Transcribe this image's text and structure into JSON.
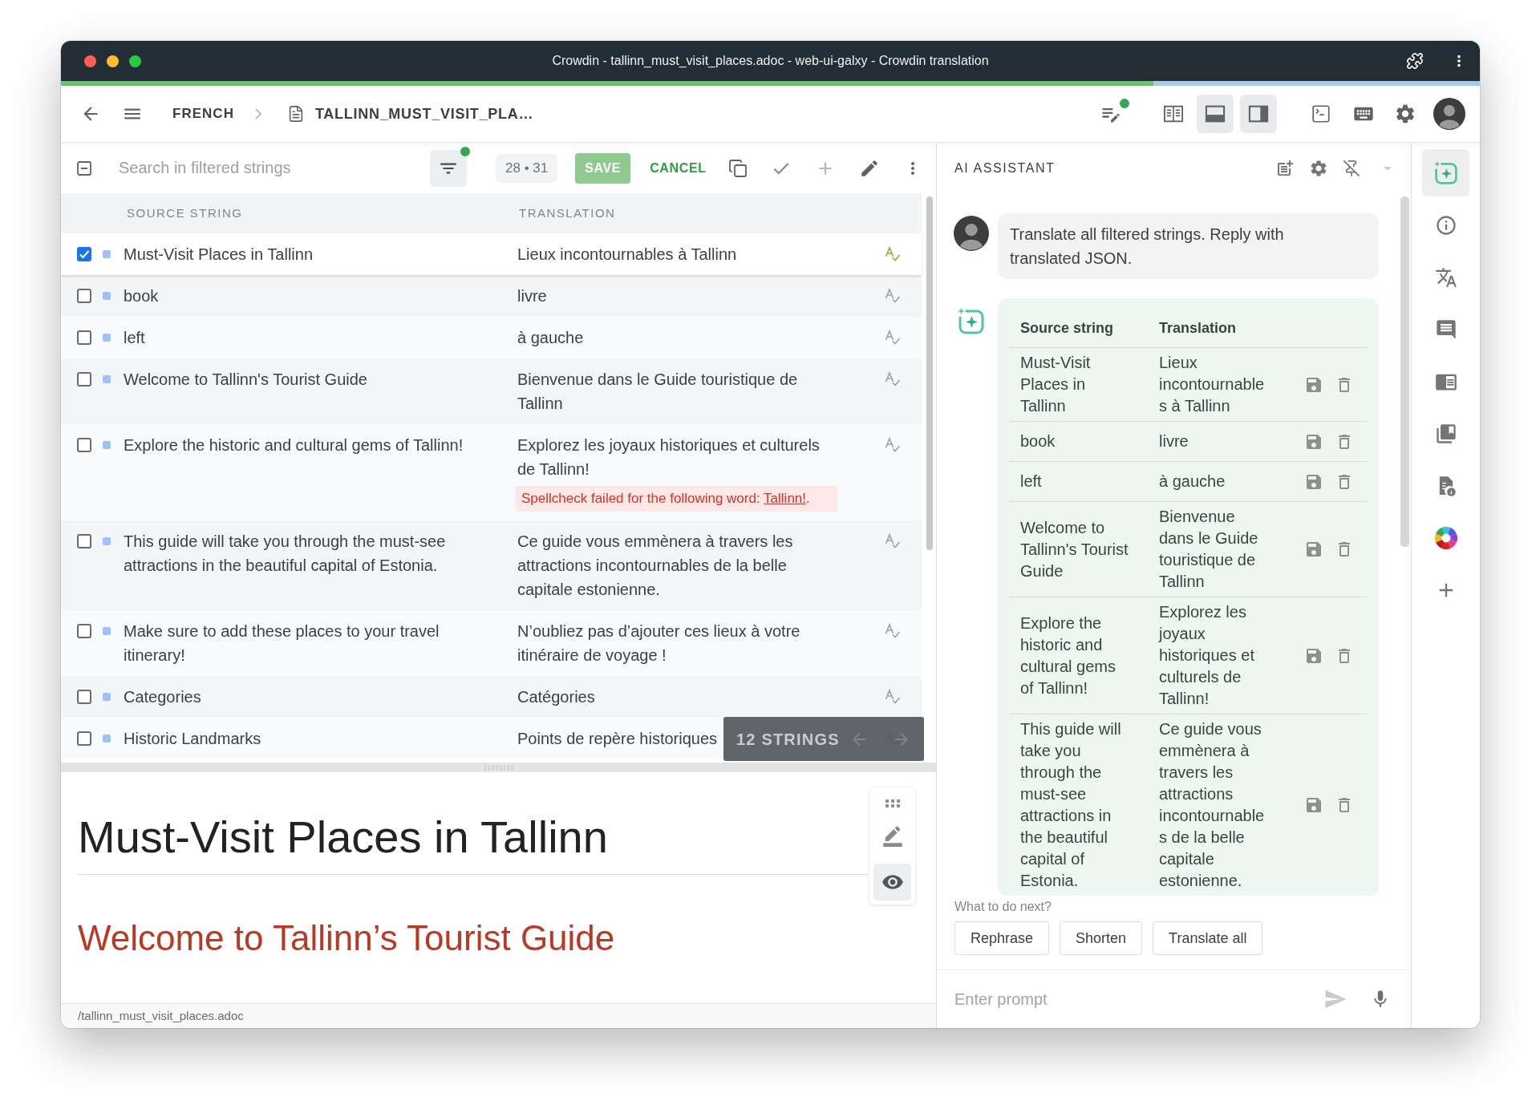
{
  "window": {
    "title": "Crowdin - tallinn_must_visit_places.adoc - web-ui-galxy - Crowdin translation"
  },
  "progress": {
    "level": 0.77
  },
  "toolbar": {
    "breadcrumb": [
      {
        "kind": "language",
        "label": "FRENCH"
      },
      {
        "kind": "file",
        "label": "TALLINN_MUST_VISIT_PLA…"
      }
    ],
    "view_toggles": [
      {
        "kind": "columns",
        "selected": false
      },
      {
        "kind": "bottom-panel",
        "selected": true
      },
      {
        "kind": "side-panel",
        "selected": true
      }
    ]
  },
  "filter_bar": {
    "search": {
      "placeholder": "Search in filtered strings"
    },
    "counter": "28 • 31",
    "save": {
      "label": "SAVE",
      "disabled": true
    },
    "cancel": "CANCEL"
  },
  "strings": {
    "columns": [
      "SOURCE STRING",
      "TRANSLATION"
    ],
    "rows": [
      {
        "checked": true,
        "selected": true,
        "source": "Must-Visit Places in Tallinn",
        "translation": "Lieux incontournables à Tallinn"
      },
      {
        "checked": false,
        "selected": false,
        "source": "book",
        "translation": "livre"
      },
      {
        "checked": false,
        "selected": false,
        "source": "left",
        "translation": "à gauche"
      },
      {
        "checked": false,
        "selected": false,
        "source": "Welcome to Tallinn's Tourist Guide",
        "translation": "Bienvenue dans le Guide touristique de Tallinn"
      },
      {
        "checked": false,
        "selected": false,
        "source": "Explore the historic and cultural gems of Tallinn!",
        "translation": "Explorez les joyaux historiques et culturels de Tallinn!",
        "spellcheck_error": {
          "message": "Spellcheck failed for the following word:",
          "word": "Tallinn!",
          "suffix": "."
        }
      },
      {
        "checked": false,
        "selected": false,
        "source": "This guide will take you through the must-see attractions in the beautiful capital of Estonia.",
        "translation": "Ce guide vous emmènera à travers les attractions incontournables de la belle capitale estonienne."
      },
      {
        "checked": false,
        "selected": false,
        "source": "Make sure to add these places to your travel itinerary!",
        "translation": "N’oubliez pas d’ajouter ces lieux à votre itinéraire de voyage !"
      },
      {
        "checked": false,
        "selected": false,
        "source": "Categories",
        "translation": "Catégories"
      },
      {
        "checked": false,
        "selected": false,
        "source": "Historic Landmarks",
        "translation": "Points de repère historiques"
      }
    ]
  },
  "strings_overlay": {
    "label": "12 STRINGS"
  },
  "preview": {
    "heading": "Must-Visit Places in Tallinn",
    "subheading": "Welcome to Tallinn’s Tourist Guide",
    "tools": [
      {
        "kind": "drag",
        "selected": false
      },
      {
        "kind": "edit",
        "selected": false
      },
      {
        "kind": "view",
        "selected": true
      }
    ]
  },
  "status_bar": {
    "path": "/tallinn_must_visit_places.adoc"
  },
  "ai_assistant": {
    "title": "AI ASSISTANT",
    "messages": [
      {
        "kind": "user",
        "text": "Translate all filtered strings. Reply with translated JSON."
      },
      {
        "kind": "assistant",
        "columns": [
          "Source string",
          "Translation"
        ],
        "rows": [
          {
            "source": "Must-Visit Places in Tallinn",
            "translation": "Lieux incontournables à Tallinn"
          },
          {
            "source": "book",
            "translation": "livre"
          },
          {
            "source": "left",
            "translation": "à gauche"
          },
          {
            "source": "Welcome to Tallinn's Tourist Guide",
            "translation": "Bienvenue dans le Guide touristique de Tallinn"
          },
          {
            "source": "Explore the historic and cultural gems of Tallinn!",
            "translation": "Explorez les joyaux historiques et culturels de Tallinn!"
          },
          {
            "source": "This guide will take you through the must-see attractions in the beautiful capital of Estonia.",
            "translation": "Ce guide vous emmènera à travers les attractions incontournables de la belle capitale estonienne."
          }
        ]
      }
    ],
    "next_label": "What to do next?",
    "suggestions": [
      "Rephrase",
      "Shorten",
      "Translate all"
    ],
    "prompt": {
      "placeholder": "Enter prompt"
    }
  },
  "sidebar": {
    "items": [
      {
        "kind": "ai",
        "selected": true
      },
      {
        "kind": "info",
        "selected": false
      },
      {
        "kind": "translate",
        "selected": false
      },
      {
        "kind": "comments",
        "selected": false
      },
      {
        "kind": "reader",
        "selected": false
      },
      {
        "kind": "bookmarks",
        "selected": false
      },
      {
        "kind": "file-info",
        "selected": false
      },
      {
        "kind": "color-wheel",
        "selected": false
      },
      {
        "kind": "add",
        "selected": false
      }
    ]
  }
}
